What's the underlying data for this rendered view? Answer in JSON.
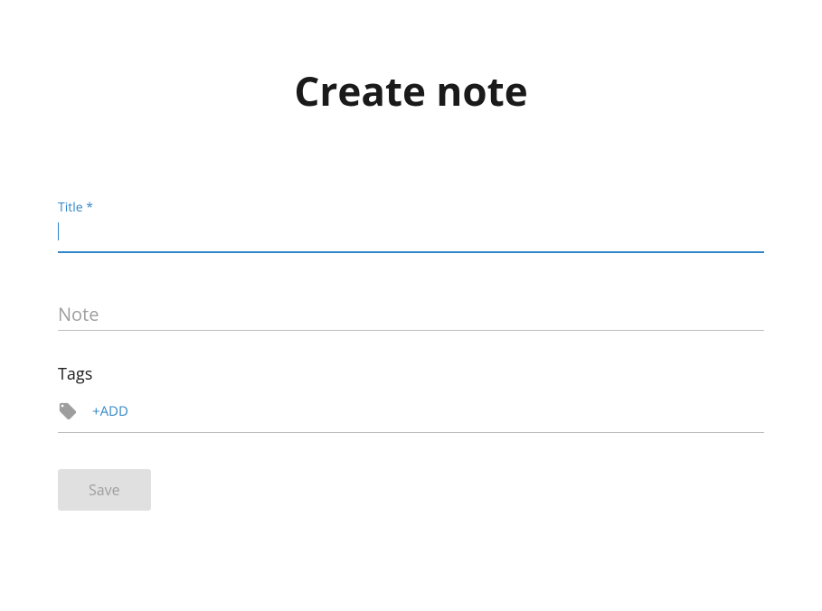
{
  "page": {
    "heading": "Create note"
  },
  "form": {
    "title": {
      "label": "Title *",
      "value": ""
    },
    "note": {
      "placeholder": "Note",
      "value": ""
    },
    "tags": {
      "label": "Tags",
      "add_label": "+ADD"
    },
    "save_label": "Save"
  }
}
